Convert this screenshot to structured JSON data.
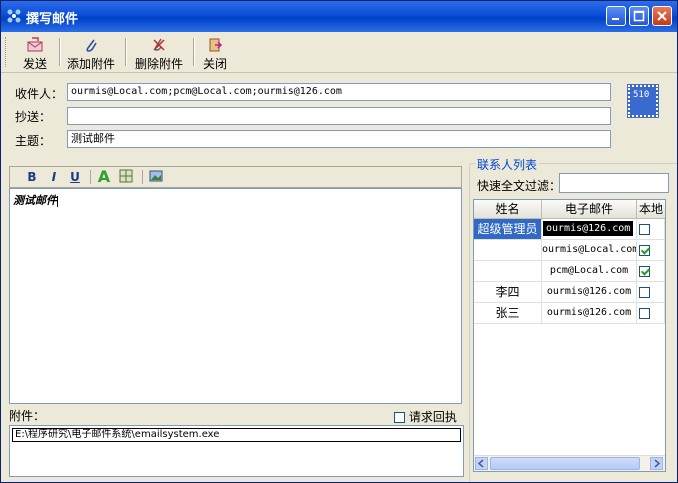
{
  "window": {
    "title": "撰写邮件",
    "minimize_icon": "minimize-icon",
    "maximize_icon": "maximize-icon",
    "close_icon": "close-icon"
  },
  "toolbar": {
    "send": "发送",
    "add_attachment": "添加附件",
    "remove_attachment": "删除附件",
    "close": "关闭"
  },
  "form": {
    "to_label": "收件人：",
    "to_value": "ourmis@Local.com;pcm@Local.com;ourmis@126.com",
    "cc_label": "抄送：",
    "cc_value": "",
    "subject_label": "主题：",
    "subject_value": "测试邮件",
    "stamp_text": "510"
  },
  "format_toolbar": {
    "bold": "B",
    "italic": "I",
    "underline": "U",
    "font_color": "A"
  },
  "editor": {
    "body": "测试邮件"
  },
  "attachments": {
    "label": "附件：",
    "request_receipt": "请求回执",
    "items": [
      "E:\\程序研究\\电子邮件系统\\emailsystem.exe"
    ]
  },
  "contacts": {
    "group_title": "联系人列表",
    "filter_label": "快速全文过滤：",
    "filter_value": "",
    "columns": [
      "姓名",
      "电子邮件",
      "本地"
    ],
    "rows": [
      {
        "name": "超级管理员",
        "email": "ourmis@126.com",
        "local": false,
        "selected": true
      },
      {
        "name": "",
        "email": "ourmis@Local.com",
        "local": true,
        "selected": false
      },
      {
        "name": "",
        "email": "pcm@Local.com",
        "local": true,
        "selected": false
      },
      {
        "name": "李四",
        "email": "ourmis@126.com",
        "local": false,
        "selected": false
      },
      {
        "name": "张三",
        "email": "ourmis@126.com",
        "local": false,
        "selected": false
      }
    ]
  },
  "colors": {
    "title_bar": "#0a4ed8",
    "selection": "#316ac5",
    "group_title": "#0046d5"
  }
}
